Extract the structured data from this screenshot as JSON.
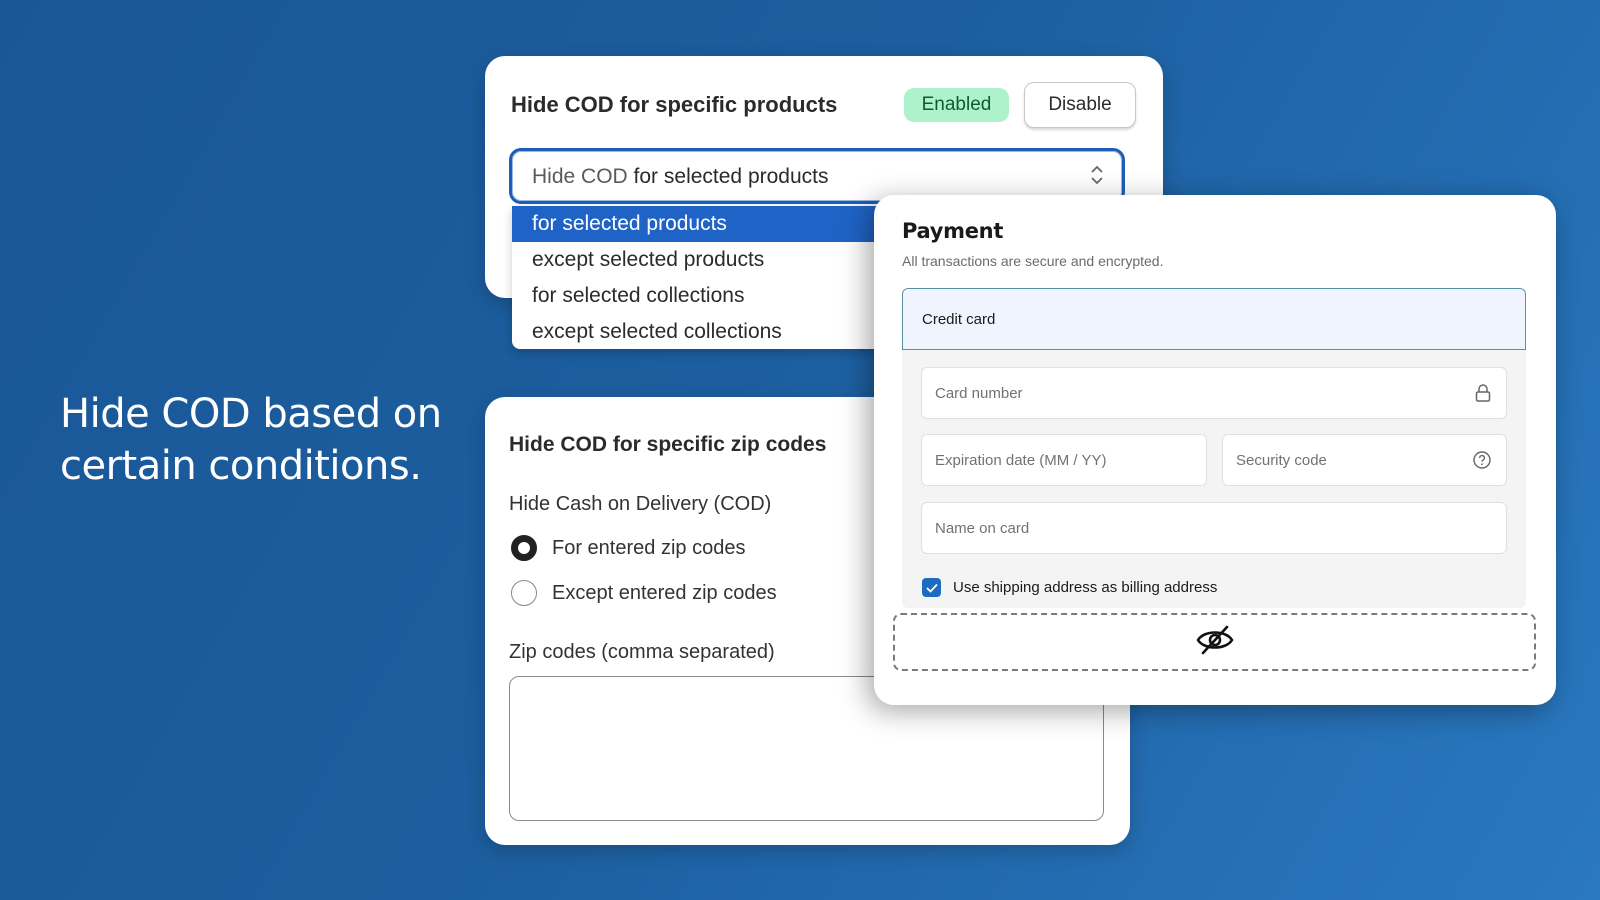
{
  "headline": {
    "line1": "Hide COD based on",
    "line2": "certain conditions."
  },
  "products_card": {
    "title": "Hide COD for specific products",
    "status_badge": "Enabled",
    "disable_button": "Disable",
    "select": {
      "value_prefix": "Hide COD",
      "value_suffix": "for selected products",
      "options": [
        {
          "label": "for selected products",
          "selected": true
        },
        {
          "label": "except selected products",
          "selected": false
        },
        {
          "label": "for selected collections",
          "selected": false
        },
        {
          "label": "except selected collections",
          "selected": false
        }
      ]
    }
  },
  "zip_card": {
    "title": "Hide COD for specific zip codes",
    "subtitle": "Hide Cash on Delivery (COD)",
    "radios": [
      {
        "label": "For entered zip codes",
        "checked": true
      },
      {
        "label": "Except entered zip codes",
        "checked": false
      }
    ],
    "zip_label": "Zip codes (comma separated)",
    "zip_value": ""
  },
  "payment_card": {
    "title": "Payment",
    "subtitle": "All transactions are secure and encrypted.",
    "method": "Credit card",
    "fields": {
      "card_number": "Card number",
      "expiration": "Expiration date (MM / YY)",
      "security_code": "Security code",
      "name_on_card": "Name on card"
    },
    "billing_checkbox": {
      "label": "Use shipping address as billing address",
      "checked": true
    },
    "hidden_method_icon": "eye-slash-icon"
  },
  "colors": {
    "background": "#1c5e9f",
    "enabled_badge": "#aef2cc",
    "select_focus": "#1d5fb8",
    "dropdown_selected": "#1f63c6",
    "checkbox": "#1b6cc0"
  }
}
